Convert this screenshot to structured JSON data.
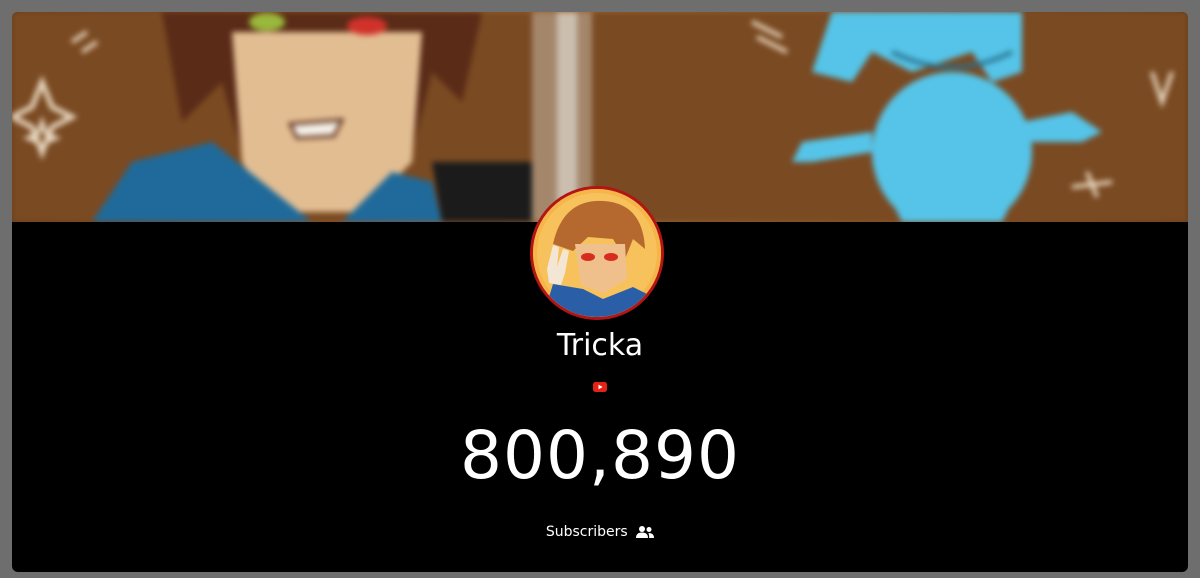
{
  "channel": {
    "name": "Tricka",
    "platform_icon": "youtube-icon",
    "subscriber_count": "800,890",
    "subscribers_label": "Subscribers",
    "subscribers_icon": "users-icon"
  },
  "colors": {
    "background": "#000000",
    "avatar_border": "#b31414",
    "youtube_red": "#e62117",
    "text": "#ffffff"
  }
}
